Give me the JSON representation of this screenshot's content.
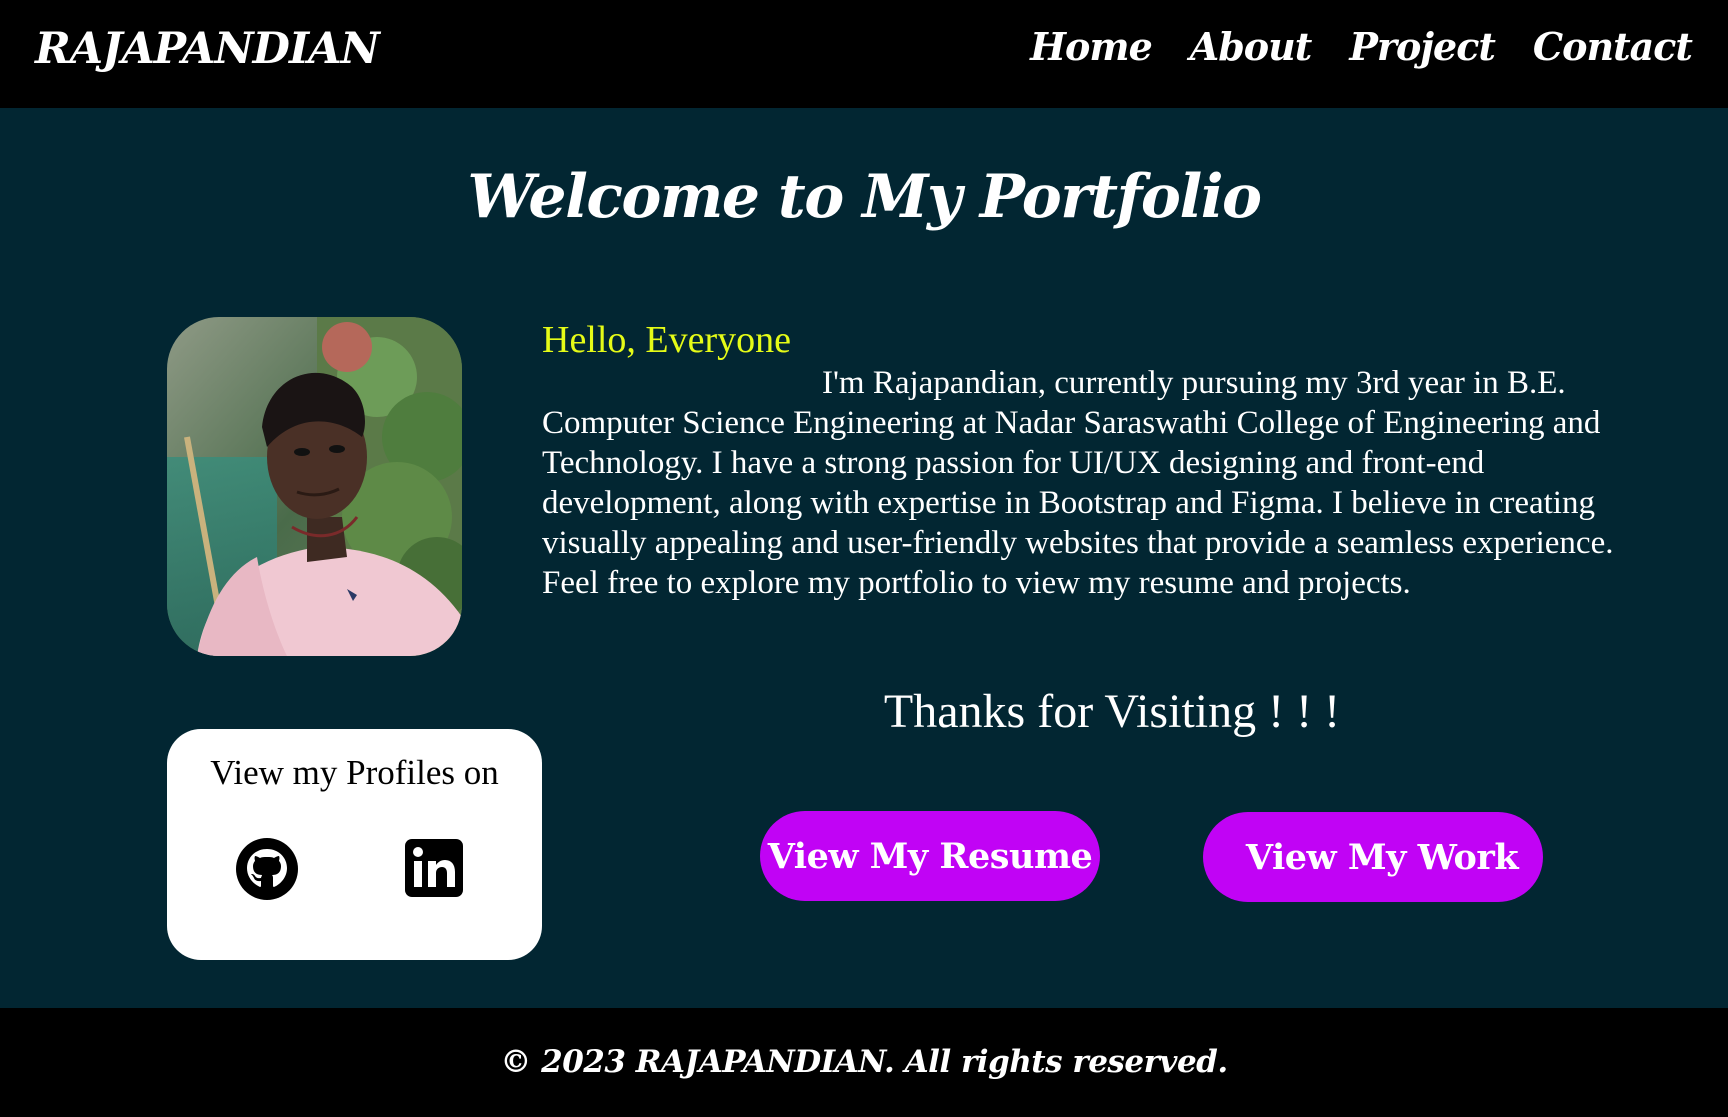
{
  "navbar": {
    "brand": "RAJAPANDIAN",
    "links": [
      "Home",
      "About",
      "Project",
      "Contact"
    ]
  },
  "hero": {
    "title": "Welcome to My Portfolio"
  },
  "about": {
    "greeting": "Hello, Everyone",
    "bio": "I'm Rajapandian, currently pursuing my 3rd year in B.E. Computer Science Engineering at Nadar Saraswathi College of Engineering and Technology. I have a strong passion for UI/UX designing and front-end development, along with expertise in Bootstrap and Figma. I believe in creating visually appealing and user-friendly websites that provide a seamless experience. Feel free to explore my portfolio to view my resume and projects.",
    "thanks": "Thanks for Visiting ! ! !"
  },
  "profiles": {
    "title": "View my Profiles on",
    "icons": [
      "github-icon",
      "linkedin-icon"
    ]
  },
  "buttons": {
    "resume": "View My Resume",
    "work": "View My Work"
  },
  "footer": {
    "text": "© 2023 RAJAPANDIAN. All rights reserved."
  },
  "colors": {
    "background": "#022632",
    "bar": "#000000",
    "accent": "#c103f5",
    "greeting": "#e5fb17"
  }
}
